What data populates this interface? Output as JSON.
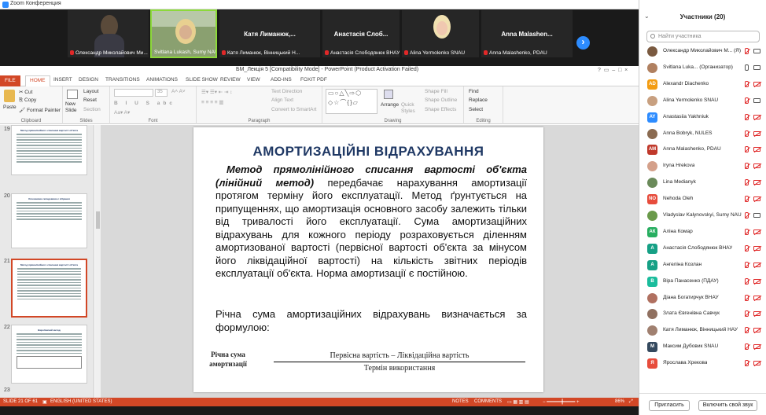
{
  "zoom": {
    "title": "Zoom Конференция"
  },
  "videos": [
    {
      "name": "Олександр Миколайович Ми..."
    },
    {
      "name": "Svitlana Lukash, Sumy NAU"
    },
    {
      "center": "Катя Лиманюк,...",
      "name": "Катя Лиманюк, Вінницький Н..."
    },
    {
      "center": "Анастасія Слоб...",
      "name": "Анастасія Слободянюк ВНАУ"
    },
    {
      "name": "Alina Yermolenko SNAU"
    },
    {
      "center": "Anna Malashen...",
      "name": "Anna Malashenko, PDAU"
    }
  ],
  "ppt": {
    "window_title": "БМ_Лекція 5 [Compatibility Mode] - PowerPoint (Product Activation Failed)",
    "tabs": [
      "FILE",
      "HOME",
      "INSERT",
      "DESIGN",
      "TRANSITIONS",
      "ANIMATIONS",
      "SLIDE SHOW",
      "REVIEW",
      "VIEW",
      "ADD-INS",
      "FOXIT PDF"
    ],
    "ribbon": {
      "paste": "Paste",
      "cut": "Cut",
      "copy": "Copy",
      "format_painter": "Format Painter",
      "clipboard": "Clipboard",
      "new_slide": "New Slide",
      "layout": "Layout",
      "reset": "Reset",
      "section": "Section",
      "slides": "Slides",
      "font": "Font",
      "font_size": "35",
      "paragraph": "Paragraph",
      "text_direction": "Text Direction",
      "align_text": "Align Text",
      "convert": "Convert to SmartArt",
      "drawing": "Drawing",
      "arrange": "Arrange",
      "quick_styles": "Quick Styles",
      "shape_fill": "Shape Fill",
      "shape_outline": "Shape Outline",
      "shape_effects": "Shape Effects",
      "find": "Find",
      "replace": "Replace",
      "select": "Select",
      "editing": "Editing"
    },
    "thumbs": [
      {
        "num": "19",
        "title": "Метод прямолінійного списання вартості об'єкта"
      },
      {
        "num": "20",
        "title": "Основними складовими є зібрання"
      },
      {
        "num": "21",
        "title": "Метод прямолінійного списання вартості об'єкта"
      },
      {
        "num": "22",
        "title": "Виробничий метод"
      },
      {
        "num": "23",
        "title": ""
      }
    ],
    "slide": {
      "title": "АМОРТИЗАЦІЙНІ ВІДРАХУВАННЯ",
      "lead": "Метод прямолінійного списання вартості об'єкта (лінійний метод)",
      "para1": " передбачає нарахування амортизації протягом терміну його експлуатації. Метод ґрунтується на припущеннях, що амортизація основного засобу залежить тільки від тривалості його експлуатації. Сума амортизаційних відрахувань для кожного періоду розраховується діленням амортизованої вартості (первісної вартості об'єкта за мінусом його ліквідаційної вартості) на кількість звітних періодів експлуатації об'єкта. Норма амортизації є постійною.",
      "para2": "Річна сума амортизаційних відрахувань визначається за формулою:",
      "formula_label": "Річна сума амортизації",
      "formula_num": "Первісна вартість – Ліквідаційна вартість",
      "formula_den": "Термін використання"
    },
    "status": {
      "slide": "SLIDE 21 OF 61",
      "lang": "ENGLISH (UNITED STATES)",
      "notes": "NOTES",
      "comments": "COMMENTS",
      "zoom": "86%"
    }
  },
  "participants": {
    "header": "Участники (20)",
    "search_placeholder": "Найти участника",
    "list": [
      {
        "name": "Олександр Миколайович М... (Я)",
        "initials": "",
        "color": "#7a5a40",
        "photo": true
      },
      {
        "name": "Svitlana Luka... (Организатор)",
        "initials": "",
        "color": "#b08060",
        "photo": true
      },
      {
        "name": "Alexandr Diachenko",
        "initials": "AD",
        "color": "#f39c12",
        "photo": false
      },
      {
        "name": "Alina Yermolenko SNAU",
        "initials": "",
        "color": "#c8a080",
        "photo": true
      },
      {
        "name": "Anastasiia Yakhniuk",
        "initials": "AY",
        "color": "#2d8cff",
        "photo": false
      },
      {
        "name": "Anna Bobryk, NULES",
        "initials": "",
        "color": "#8a6a50",
        "photo": true
      },
      {
        "name": "Anna Malashenko, PDAU",
        "initials": "AM",
        "color": "#c0392b",
        "photo": false
      },
      {
        "name": "Iryna Hrekova",
        "initials": "",
        "color": "#d4a08a",
        "photo": true
      },
      {
        "name": "Lina Medianyk",
        "initials": "",
        "color": "#6a8a5a",
        "photo": true
      },
      {
        "name": "Nehoda Oleh",
        "initials": "NO",
        "color": "#e74c3c",
        "photo": false
      },
      {
        "name": "Vladyslav Kalynovskyi, Sumy NAU",
        "initials": "",
        "color": "#6a9a4a",
        "photo": true
      },
      {
        "name": "Аліна Комар",
        "initials": "АК",
        "color": "#27ae60",
        "photo": false
      },
      {
        "name": "Анастасія Слободянюк ВНАУ",
        "initials": "А",
        "color": "#16a085",
        "photo": false
      },
      {
        "name": "Ангеліна Козлан",
        "initials": "А",
        "color": "#16a085",
        "photo": false
      },
      {
        "name": "Віра Панасенко (ПДАУ)",
        "initials": "В",
        "color": "#1abc9c",
        "photo": false
      },
      {
        "name": "Діана Богатирчук ВНАУ",
        "initials": "",
        "color": "#b07060",
        "photo": true
      },
      {
        "name": "Злата Євгенівна Савчук",
        "initials": "",
        "color": "#907060",
        "photo": true
      },
      {
        "name": "Катя Лиманюк, Вінницький НАУ",
        "initials": "",
        "color": "#a08070",
        "photo": true
      },
      {
        "name": "Максим Дубовик SNAU",
        "initials": "М",
        "color": "#34495e",
        "photo": false
      },
      {
        "name": "Ярослава Хрекова",
        "initials": "Я",
        "color": "#e74c3c",
        "photo": false
      }
    ],
    "invite": "Пригласить",
    "unmute": "Включить свой звук"
  }
}
